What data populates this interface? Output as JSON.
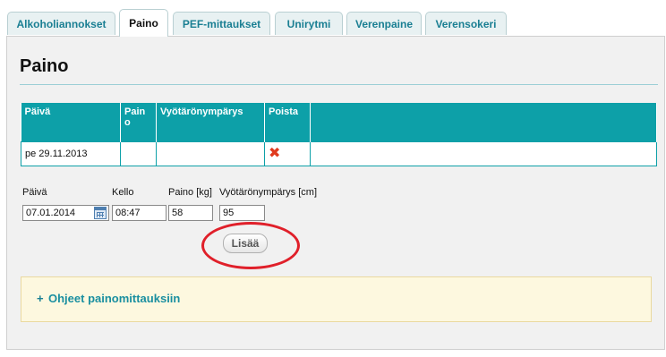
{
  "tabs": [
    {
      "label": "Alkoholiannokset",
      "active": false
    },
    {
      "label": "Paino",
      "active": true
    },
    {
      "label": "PEF-mittaukset",
      "active": false
    },
    {
      "label": "Unirytmi",
      "active": false
    },
    {
      "label": "Verenpaine",
      "active": false
    },
    {
      "label": "Verensokeri",
      "active": false
    }
  ],
  "page": {
    "title": "Paino"
  },
  "table": {
    "headers": [
      "Päivä",
      "Pain o",
      "Vyötärönympärys",
      "Poista",
      ""
    ],
    "rows": [
      {
        "date": "pe 29.11.2013",
        "weight": "",
        "waist": "",
        "delete_icon": "red-x-icon"
      }
    ]
  },
  "form": {
    "date_label": "Päivä",
    "time_label": "Kello",
    "weight_label": "Paino [kg]",
    "waist_label": "Vyötärönympärys [cm]",
    "date_value": "07.01.2014",
    "time_value": "08:47",
    "weight_value": "58",
    "waist_value": "95",
    "add_label": "Lisää",
    "calendar_icon": "calendar-icon"
  },
  "help": {
    "plus": "+",
    "link_text": "Ohjeet painomittauksiin"
  },
  "colors": {
    "accent": "#0da0a8",
    "link": "#1a8fa0",
    "highlight": "#e0202a",
    "help_bg": "#fdf8df"
  }
}
